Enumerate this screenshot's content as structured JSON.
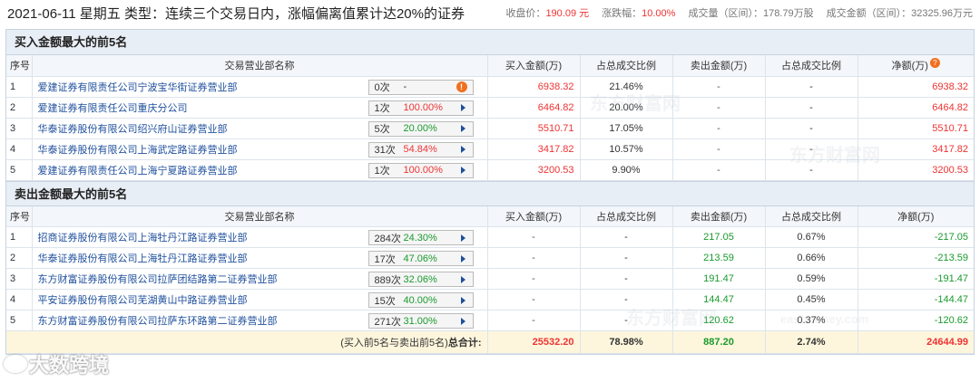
{
  "header": {
    "title": "2021-06-11 星期五 类型：连续三个交易日内，涨幅偏离值累计达20%的证券",
    "close_label": "收盘价：",
    "close_value": "190.09 元",
    "change_label": "涨跌幅：",
    "change_value": "10.00%",
    "volume_label": "成交量（区间）：",
    "volume_value": "178.79万股",
    "amount_label": "成交金额（区间）：",
    "amount_value": "32325.96万元"
  },
  "buy_section": {
    "title": "买入金额最大的前5名",
    "columns": [
      "序号",
      "交易营业部名称",
      "买入金额(万)",
      "占总成交比例",
      "卖出金额(万)",
      "占总成交比例",
      "净额(万)"
    ],
    "rows": [
      {
        "idx": "1",
        "name": "爱建证券有限责任公司宁波宝华街证券营业部",
        "count": "0次",
        "rate": "-",
        "buy": "6938.32",
        "buy_pct": "21.46%",
        "sell": "-",
        "sell_pct": "-",
        "net": "6938.32"
      },
      {
        "idx": "2",
        "name": "爱建证券有限责任公司重庆分公司",
        "count": "1次",
        "rate": "100.00%",
        "buy": "6464.82",
        "buy_pct": "20.00%",
        "sell": "-",
        "sell_pct": "-",
        "net": "6464.82"
      },
      {
        "idx": "3",
        "name": "华泰证券股份有限公司绍兴府山证券营业部",
        "count": "5次",
        "rate": "20.00%",
        "buy": "5510.71",
        "buy_pct": "17.05%",
        "sell": "-",
        "sell_pct": "-",
        "net": "5510.71"
      },
      {
        "idx": "4",
        "name": "华泰证券股份有限公司上海武定路证券营业部",
        "count": "31次",
        "rate": "54.84%",
        "buy": "3417.82",
        "buy_pct": "10.57%",
        "sell": "-",
        "sell_pct": "-",
        "net": "3417.82"
      },
      {
        "idx": "5",
        "name": "爱建证券有限责任公司上海宁夏路证券营业部",
        "count": "1次",
        "rate": "100.00%",
        "buy": "3200.53",
        "buy_pct": "9.90%",
        "sell": "-",
        "sell_pct": "-",
        "net": "3200.53"
      }
    ]
  },
  "sell_section": {
    "title": "卖出金额最大的前5名",
    "columns": [
      "序号",
      "交易营业部名称",
      "买入金额(万)",
      "占总成交比例",
      "卖出金额(万)",
      "占总成交比例",
      "净额(万)"
    ],
    "rows": [
      {
        "idx": "1",
        "name": "招商证券股份有限公司上海牡丹江路证券营业部",
        "count": "284次",
        "rate": "24.30%",
        "buy": "-",
        "buy_pct": "-",
        "sell": "217.05",
        "sell_pct": "0.67%",
        "net": "-217.05"
      },
      {
        "idx": "2",
        "name": "华泰证券股份有限公司上海牡丹江路证券营业部",
        "count": "17次",
        "rate": "47.06%",
        "buy": "-",
        "buy_pct": "-",
        "sell": "213.59",
        "sell_pct": "0.66%",
        "net": "-213.59"
      },
      {
        "idx": "3",
        "name": "东方财富证券股份有限公司拉萨团结路第二证券营业部",
        "count": "889次",
        "rate": "32.06%",
        "buy": "-",
        "buy_pct": "-",
        "sell": "191.47",
        "sell_pct": "0.59%",
        "net": "-191.47"
      },
      {
        "idx": "4",
        "name": "平安证券股份有限公司芜湖黄山中路证券营业部",
        "count": "15次",
        "rate": "40.00%",
        "buy": "-",
        "buy_pct": "-",
        "sell": "144.47",
        "sell_pct": "0.45%",
        "net": "-144.47"
      },
      {
        "idx": "5",
        "name": "东方财富证券股份有限公司拉萨东环路第二证券营业部",
        "count": "271次",
        "rate": "31.00%",
        "buy": "-",
        "buy_pct": "-",
        "sell": "120.62",
        "sell_pct": "0.37%",
        "net": "-120.62"
      }
    ],
    "total": {
      "label_prefix": "(买入前5名与卖出前5名)",
      "label_bold": "总合计:",
      "buy": "25532.20",
      "buy_pct": "78.98%",
      "sell": "887.20",
      "sell_pct": "2.74%",
      "net": "24644.99"
    }
  },
  "watermarks": [
    "东方财富网",
    "eastmoney.com"
  ],
  "logo_text": "大数跨境",
  "colors": {
    "up": "#e33333",
    "down": "#1a9a2e",
    "link": "#1e4f9c",
    "total_bg": "#fdf6dc",
    "header_bg": "#e8eef5"
  }
}
